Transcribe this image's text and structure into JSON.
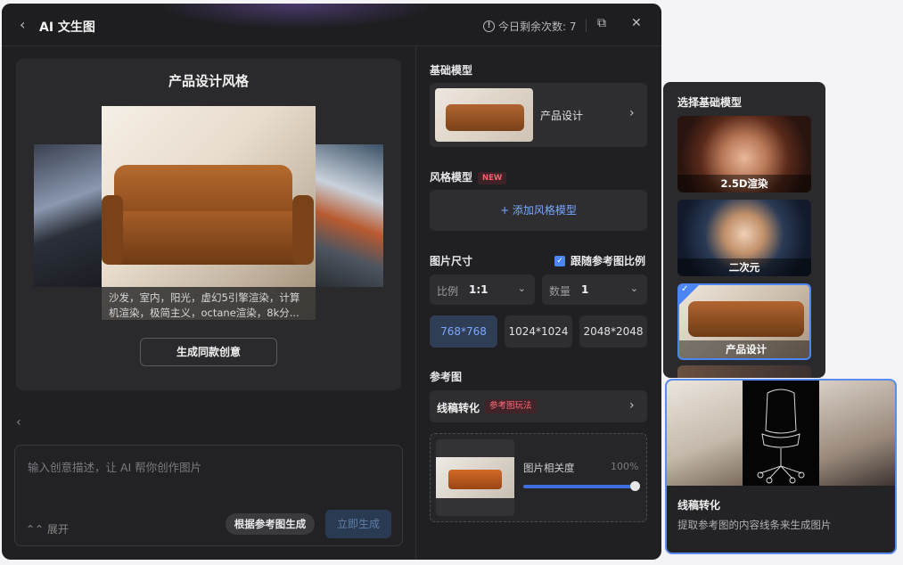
{
  "header": {
    "back_icon": "chevron-left-icon",
    "title": "AI 文生图",
    "quota": "今日剩余次数: 7"
  },
  "showcase": {
    "title": "产品设计风格",
    "caption": "沙发，室内，阳光，虚幻5引擎渲染，计算机渲染，极简主义，octane渲染，8k分...",
    "same_button": "生成同款创意"
  },
  "prompt": {
    "placeholder": "输入创意描述，让 AI 帮你创作图片",
    "expand": "展开",
    "ref_generate": "根据参考图生成",
    "generate_now": "立即生成"
  },
  "settings": {
    "base_model_label": "基础模型",
    "base_model_name": "产品设计",
    "style_model_label": "风格模型",
    "new_badge": "NEW",
    "add_style": "+ 添加风格模型",
    "size_label": "图片尺寸",
    "follow_ref_ratio": "跟随参考图比例",
    "ratio_label": "比例",
    "ratio_value": "1:1",
    "count_label": "数量",
    "count_value": "1",
    "sizes": [
      "768*768",
      "1024*1024",
      "2048*2048"
    ],
    "active_size": "768*768",
    "ref_label": "参考图",
    "lineart": "线稿转化",
    "ref_badge": "参考图玩法",
    "relevance_label": "图片相关度",
    "relevance_value": "100%"
  },
  "model_panel": {
    "title": "选择基础模型",
    "items": [
      "2.5D渲染",
      "二次元",
      "产品设计"
    ],
    "selected": "产品设计"
  },
  "tooltip": {
    "title": "线稿转化",
    "desc": "提取参考图的内容线条来生成图片"
  },
  "colors": {
    "accent": "#4c86f5",
    "badge_red": "#ff5c6c",
    "bg": "#202023"
  }
}
